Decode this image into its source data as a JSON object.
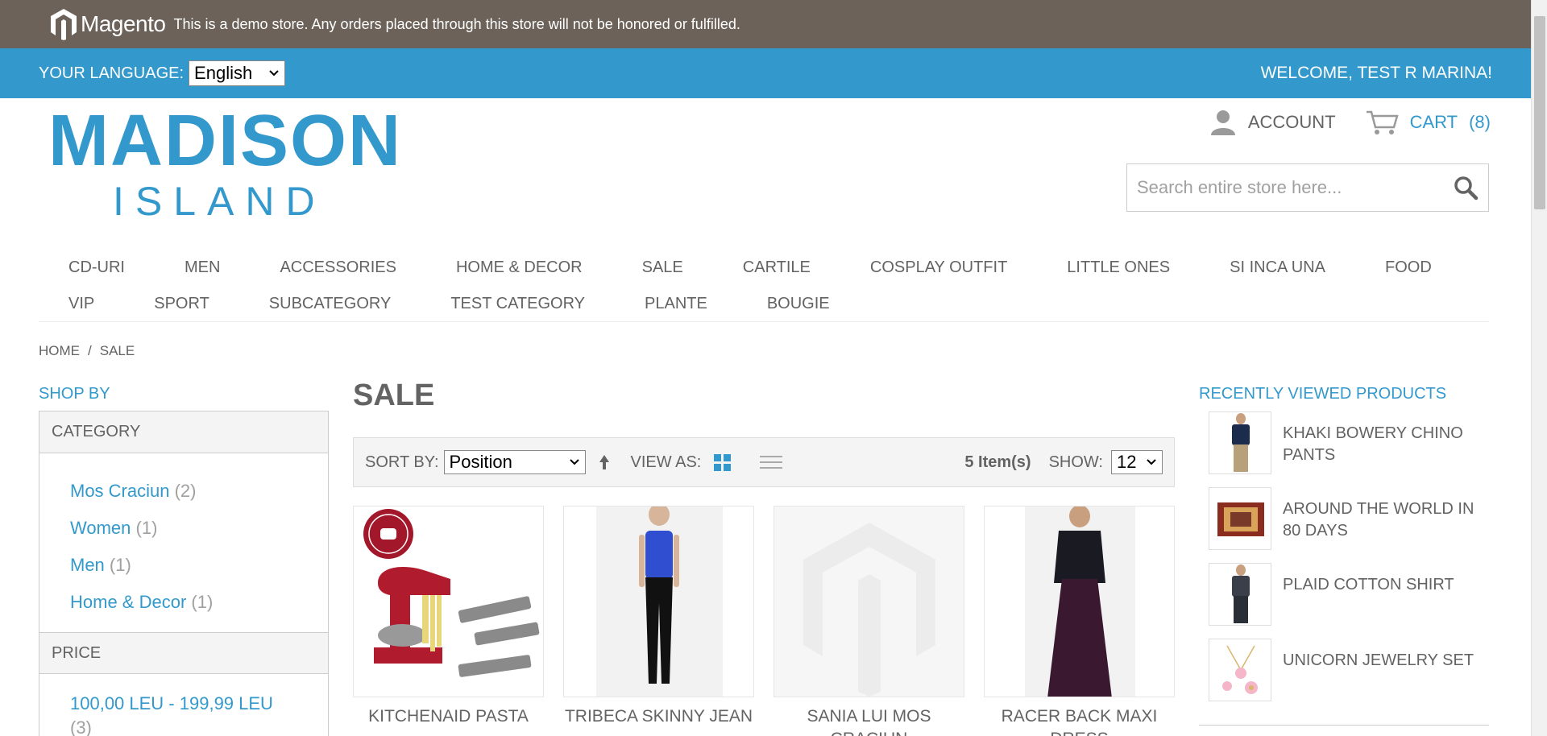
{
  "demo_notice": {
    "logo_text": "Magento",
    "text": "This is a demo store. Any orders placed through this store will not be honored or fulfilled."
  },
  "language_bar": {
    "label": "YOUR LANGUAGE:",
    "selected_language": "English",
    "welcome": "WELCOME, TEST R MARINA!"
  },
  "store_logo": {
    "line1": "MADISON",
    "line2": "ISLAND"
  },
  "header": {
    "account_label": "ACCOUNT",
    "cart_label": "CART",
    "cart_count": "(8)",
    "search_placeholder": "Search entire store here..."
  },
  "nav": {
    "row1": [
      "CD-URI",
      "MEN",
      "ACCESSORIES",
      "HOME & DECOR",
      "SALE",
      "CARTILE",
      "COSPLAY OUTFIT",
      "LITTLE ONES",
      "SI INCA UNA",
      "FOOD"
    ],
    "row2": [
      "VIP",
      "SPORT",
      "SUBCATEGORY",
      "TEST CATEGORY",
      "PLANTE",
      "BOUGIE"
    ]
  },
  "breadcrumb": {
    "home": "HOME",
    "separator": "/",
    "current": "SALE"
  },
  "sidebar": {
    "shop_by": "SHOP BY",
    "category_heading": "CATEGORY",
    "categories": [
      {
        "label": "Mos Craciun",
        "count": "(2)"
      },
      {
        "label": "Women",
        "count": "(1)"
      },
      {
        "label": "Men",
        "count": "(1)"
      },
      {
        "label": "Home & Decor",
        "count": "(1)"
      }
    ],
    "price_heading": "PRICE",
    "price_range": {
      "label": "100,00 LEU - 199,99 LEU",
      "count": "(3)"
    }
  },
  "main": {
    "title": "SALE",
    "toolbar": {
      "sort_label": "SORT BY:",
      "sort_value": "Position",
      "view_label": "VIEW AS:",
      "items_count": "5 Item(s)",
      "show_label": "SHOW:",
      "show_value": "12"
    },
    "products": [
      {
        "name": "KITCHENAID PASTA",
        "image": "kitchenaid-mixer-image"
      },
      {
        "name": "TRIBECA SKINNY JEAN",
        "image": "skinny-jean-model-image"
      },
      {
        "name": "SANIA LUI MOS CRACIUN",
        "image": "placeholder-image"
      },
      {
        "name": "RACER BACK MAXI DRESS",
        "image": "maxi-dress-model-image"
      }
    ]
  },
  "recently_viewed": {
    "title": "RECENTLY VIEWED PRODUCTS",
    "items": [
      {
        "name": "KHAKI BOWERY CHINO PANTS"
      },
      {
        "name": "AROUND THE WORLD IN 80 DAYS"
      },
      {
        "name": "PLAID COTTON SHIRT"
      },
      {
        "name": "UNICORN JEWELRY SET"
      }
    ]
  },
  "colors": {
    "accent": "#3399cc",
    "demo_bar": "#6c6259",
    "text": "#636363"
  }
}
